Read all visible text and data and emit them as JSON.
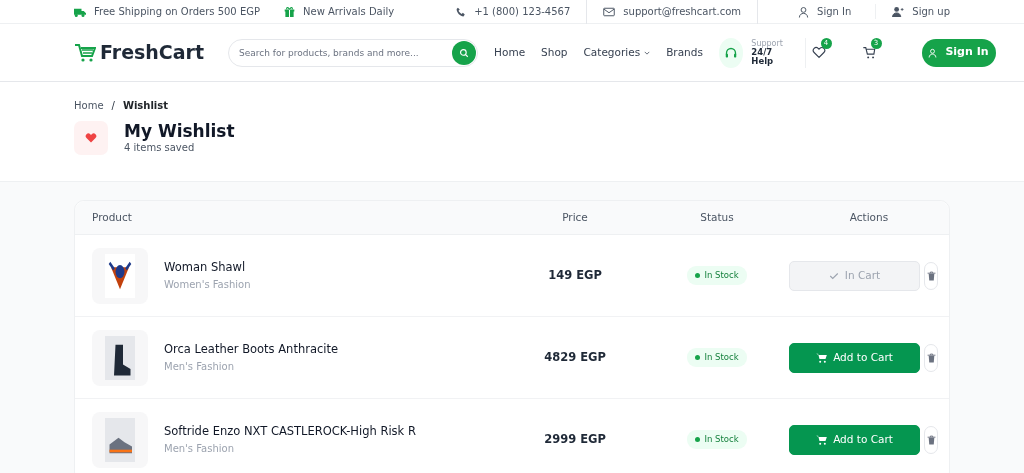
{
  "top_bar": {
    "shipping": "Free Shipping on Orders 500 EGP",
    "arrivals": "New Arrivals Daily",
    "phone": "+1 (800) 123-4567",
    "email": "support@freshcart.com",
    "sign_in": "Sign In",
    "sign_up": "Sign up"
  },
  "navbar": {
    "logo": "FreshCart",
    "search_placeholder": "Search for products, brands and more...",
    "links": [
      "Home",
      "Shop",
      "Categories",
      "Brands"
    ],
    "support_label": "Support",
    "support_value": "24/7 Help",
    "wishlist_count": "4",
    "cart_count": "3",
    "sign_in": "Sign In"
  },
  "breadcrumb": [
    {
      "label": "Home",
      "selected": false
    },
    {
      "label": "Wishlist",
      "selected": true
    }
  ],
  "breadcrumb_separator": "/",
  "header": {
    "title": "My Wishlist",
    "subtitle": "4 items saved"
  },
  "table": {
    "columns": [
      "Product",
      "Price",
      "Status",
      "Actions"
    ],
    "rows": [
      {
        "name": "Woman Shawl",
        "category": "Women's Fashion",
        "price": "149 EGP",
        "status": "In Stock",
        "in_cart": true,
        "action": "In Cart"
      },
      {
        "name": "Orca Leather Boots Anthracite",
        "category": "Men's Fashion",
        "price": "4829 EGP",
        "status": "In Stock",
        "in_cart": false,
        "action": "Add to Cart"
      },
      {
        "name": "Softride Enzo NXT CASTLEROCK-High Risk R",
        "category": "Men's Fashion",
        "price": "2999 EGP",
        "status": "In Stock",
        "in_cart": false,
        "action": "Add to Cart"
      }
    ]
  }
}
